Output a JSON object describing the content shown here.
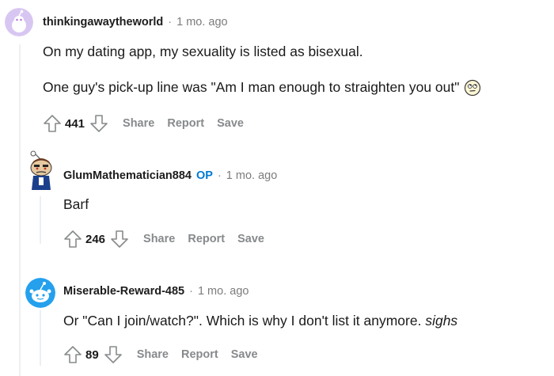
{
  "comments": [
    {
      "username": "thinkingawaytheworld",
      "dot": "·",
      "time": "1 mo. ago",
      "paragraphs": [
        "On my dating app, my sexuality is listed as bisexual.",
        "One guy's pick-up line was \"Am I man enough to straighten you out\""
      ],
      "emoji": "face-with-rolling-eyes-icon",
      "score": "441",
      "actions": {
        "share": "Share",
        "report": "Report",
        "save": "Save"
      }
    },
    {
      "username": "GlumMathematician884",
      "op_badge": "OP",
      "dot": "·",
      "time": "1 mo. ago",
      "text": "Barf",
      "score": "246",
      "actions": {
        "share": "Share",
        "report": "Report",
        "save": "Save"
      }
    },
    {
      "username": "Miserable-Reward-485",
      "dot": "·",
      "time": "1 mo. ago",
      "text_main": "Or \"Can I join/watch?\". Which is why I don't list it anymore. ",
      "text_italic": "sighs",
      "score": "89",
      "actions": {
        "share": "Share",
        "report": "Report",
        "save": "Save"
      }
    }
  ],
  "colors": {
    "op_badge": "#0079d3",
    "meta_gray": "#878a8c",
    "thread_line": "#edeff1"
  }
}
